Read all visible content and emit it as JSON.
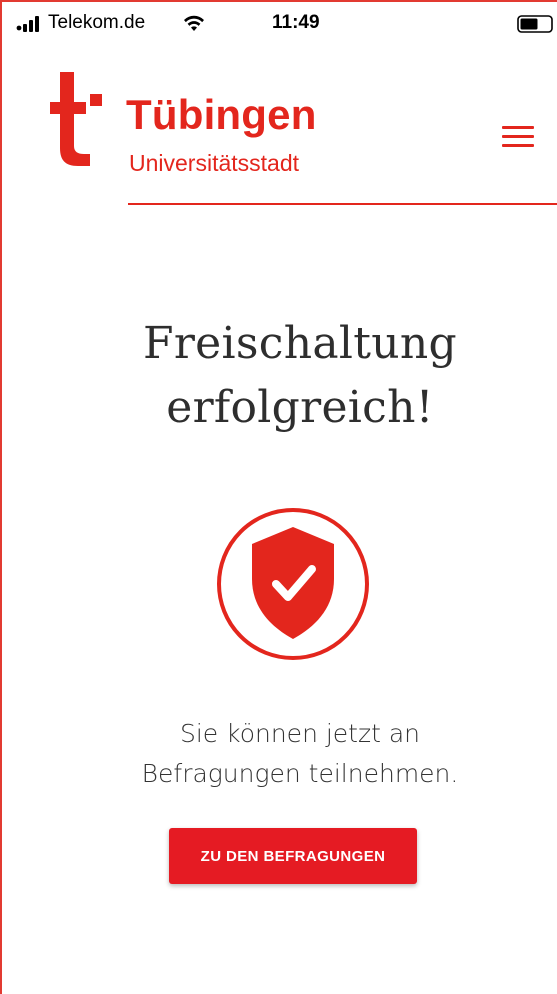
{
  "status_bar": {
    "carrier": "Telekom.de",
    "time": "11:49",
    "signal_icon": "signal-bars-icon",
    "wifi_icon": "wifi-icon",
    "battery_icon": "battery-icon"
  },
  "header": {
    "logo_letter": "t",
    "title": "Tübingen",
    "subtitle": "Universitätsstadt",
    "menu_icon": "hamburger-menu-icon"
  },
  "main": {
    "headline_line1": "Freischaltung",
    "headline_line2": "erfolgreich!",
    "status_icon": "shield-check-icon",
    "message_line1": "Sie können jetzt an",
    "message_line2": "Befragungen teilnehmen.",
    "cta_label": "ZU DEN BEFRAGUNGEN"
  },
  "colors": {
    "accent": "#e3261d",
    "button": "#e51b23",
    "text": "#2e2e2e",
    "background": "#ffffff"
  }
}
